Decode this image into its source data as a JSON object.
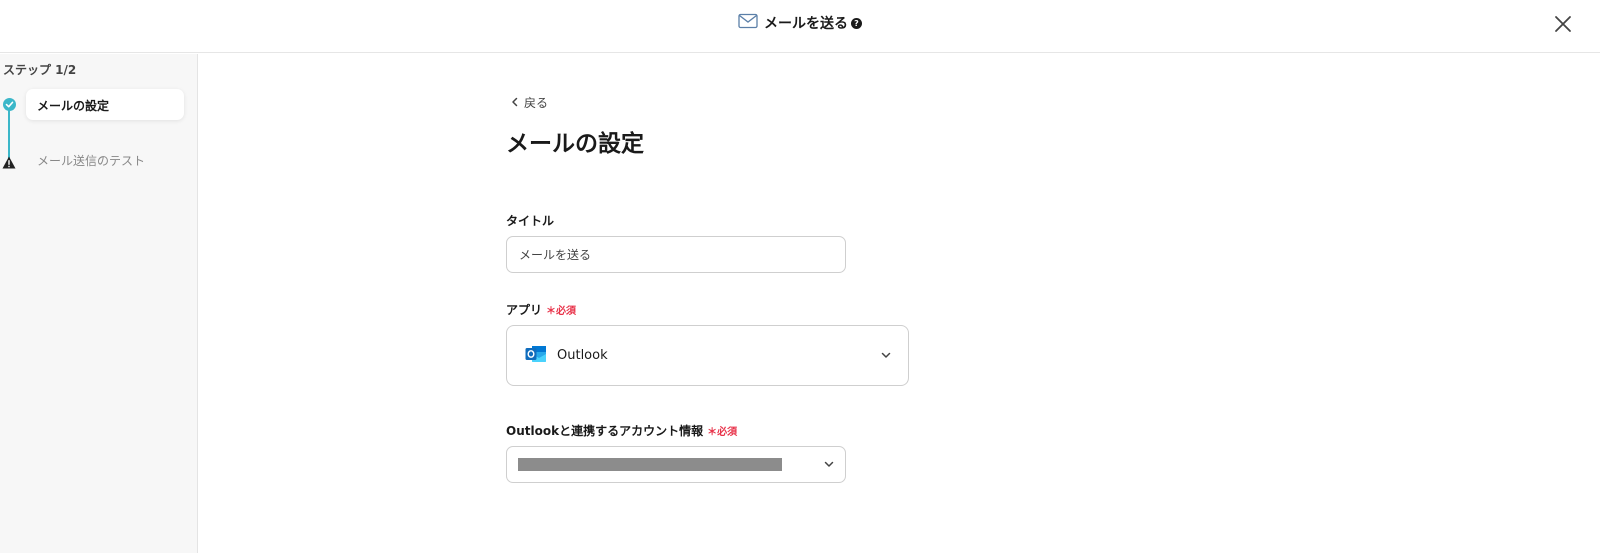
{
  "header": {
    "title": "メールを送る",
    "help_glyph": "?",
    "icon": "envelope-icon",
    "close_icon": "close-icon"
  },
  "sidebar": {
    "step_counter": "ステップ 1/2",
    "steps": [
      {
        "label": "メールの設定",
        "status": "complete",
        "active": true
      },
      {
        "label": "メール送信のテスト",
        "status": "warning",
        "active": false
      }
    ]
  },
  "main": {
    "back_label": "戻る",
    "page_title": "メールの設定",
    "title_field": {
      "label": "タイトル",
      "value": "メールを送る"
    },
    "app_field": {
      "label": "アプリ",
      "required_label": "必須",
      "value": "Outlook",
      "icon": "outlook-icon"
    },
    "account_field": {
      "label": "Outlookと連携するアカウント情報",
      "required_label": "必須"
    }
  },
  "colors": {
    "accent": "#3bb7c9",
    "required": "#e8334a",
    "outlook_blue": "#0f6cbd"
  }
}
